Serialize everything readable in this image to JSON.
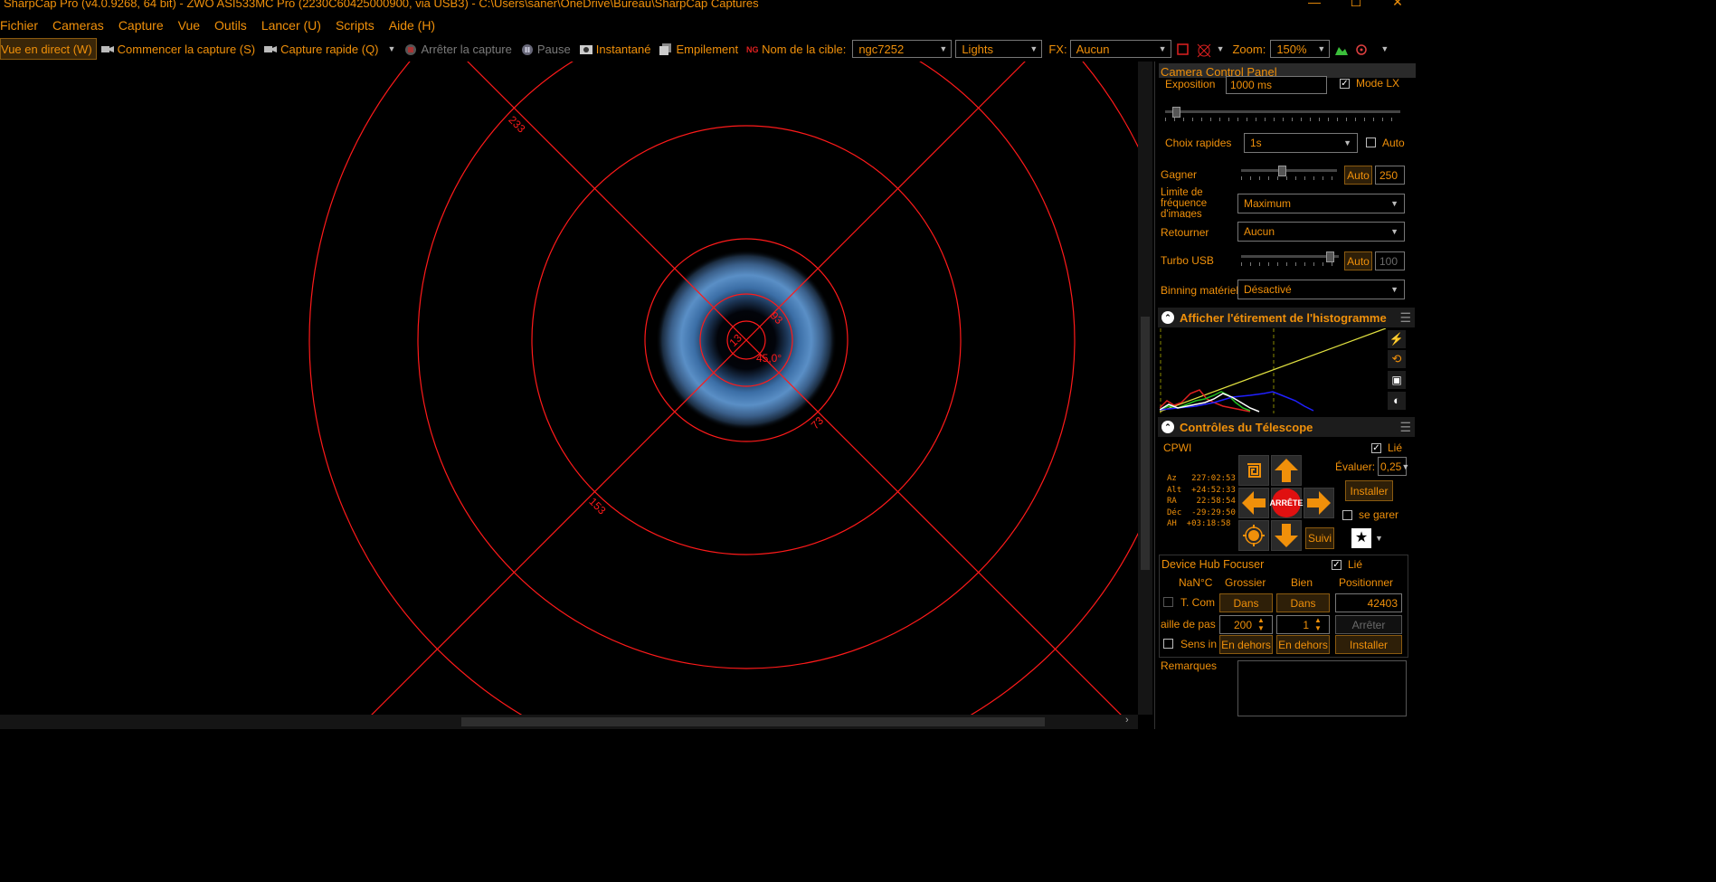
{
  "window": {
    "title": "SharpCap Pro (v4.0.9268, 64 bit) - ZWO ASI533MC Pro (2230C60425000900, via USB3) - C:\\Users\\saner\\OneDrive\\Bureau\\SharpCap Captures",
    "controls": {
      "minimize": "—",
      "maximize": "☐",
      "close": "✕"
    }
  },
  "menu": [
    "Fichier",
    "Cameras",
    "Capture",
    "Vue",
    "Outils",
    "Lancer (U)",
    "Scripts",
    "Aide (H)"
  ],
  "toolbar": {
    "live_view": "Vue en direct (W)",
    "start_capture": "Commencer la capture (S)",
    "quick_capture": "Capture rapide (Q)",
    "stop_capture": "Arrêter la capture",
    "pause": "Pause",
    "snapshot": "Instantané",
    "stack": "Empilement",
    "target_label": "Nom de la cible:",
    "target_value": "ngc7252",
    "frame_type": "Lights",
    "fx_label": "FX:",
    "fx_value": "Aucun",
    "zoom_label": "Zoom:",
    "zoom_value": "150%"
  },
  "reticle": {
    "color": "#ff1a1a",
    "labels": {
      "l233": "233",
      "l93": "93",
      "l13": "13",
      "angle": "45,0°",
      "l73": "73",
      "l153": "153"
    }
  },
  "camera_panel": {
    "title": "Camera Control Panel",
    "exposure_label": "Exposition",
    "exposure_value": "1000 ms",
    "lx_mode_label": "Mode LX",
    "lx_mode_checked": true,
    "exposure_level": 0.03,
    "quick_choice_label": "Choix rapides",
    "quick_choice_value": "1s",
    "auto_label": "Auto",
    "gain_label": "Gagner",
    "gain_auto": "Auto",
    "gain_value": "250",
    "gain_level": 0.42,
    "frame_rate_label": "Limite de fréquence d'images",
    "frame_rate_value": "Maximum",
    "flip_label": "Retourner",
    "flip_value": "Aucun",
    "usb_turbo_label": "Turbo USB",
    "usb_turbo_auto": "Auto",
    "usb_turbo_value": "100",
    "usb_turbo_level": 0.95,
    "binning_label": "Binning matériel",
    "binning_value": "Désactivé"
  },
  "histogram": {
    "title": "Afficher l'étirement de l'histogramme"
  },
  "telescope": {
    "title": "Contrôles du Télescope",
    "mount": "CPWI",
    "linked_label": "Lié",
    "rate_label": "Évaluer:",
    "rate_value": "0,25",
    "install_label": "Installer",
    "park_label": "se garer",
    "stop_label": "ARRÊTE",
    "track_label": "Suivi",
    "coords": [
      {
        "k": "Az",
        "v": "227:02:53"
      },
      {
        "k": "Alt",
        "v": "+24:52:33"
      },
      {
        "k": "RA",
        "v": "22:58:54"
      },
      {
        "k": "Déc",
        "v": "-29:29:50"
      },
      {
        "k": "AH",
        "v": "+03:18:58"
      }
    ]
  },
  "focuser": {
    "title": "Device Hub Focuser",
    "linked_label": "Lié",
    "temp": "NaN°C",
    "coarse_label": "Grossier",
    "fine_label": "Bien",
    "position_label": "Positionner",
    "temp_comp_label": "T. Com",
    "coarse_in": "Dans",
    "fine_in": "Dans",
    "position_value": "42403",
    "step_size_label": "aille de pas",
    "coarse_step": "200",
    "fine_step": "1",
    "stop_label": "Arrêter",
    "reverse_label": "Sens in",
    "coarse_out": "En dehors",
    "fine_out": "En dehors",
    "install_label": "Installer"
  },
  "notes": {
    "label": "Remarques"
  }
}
